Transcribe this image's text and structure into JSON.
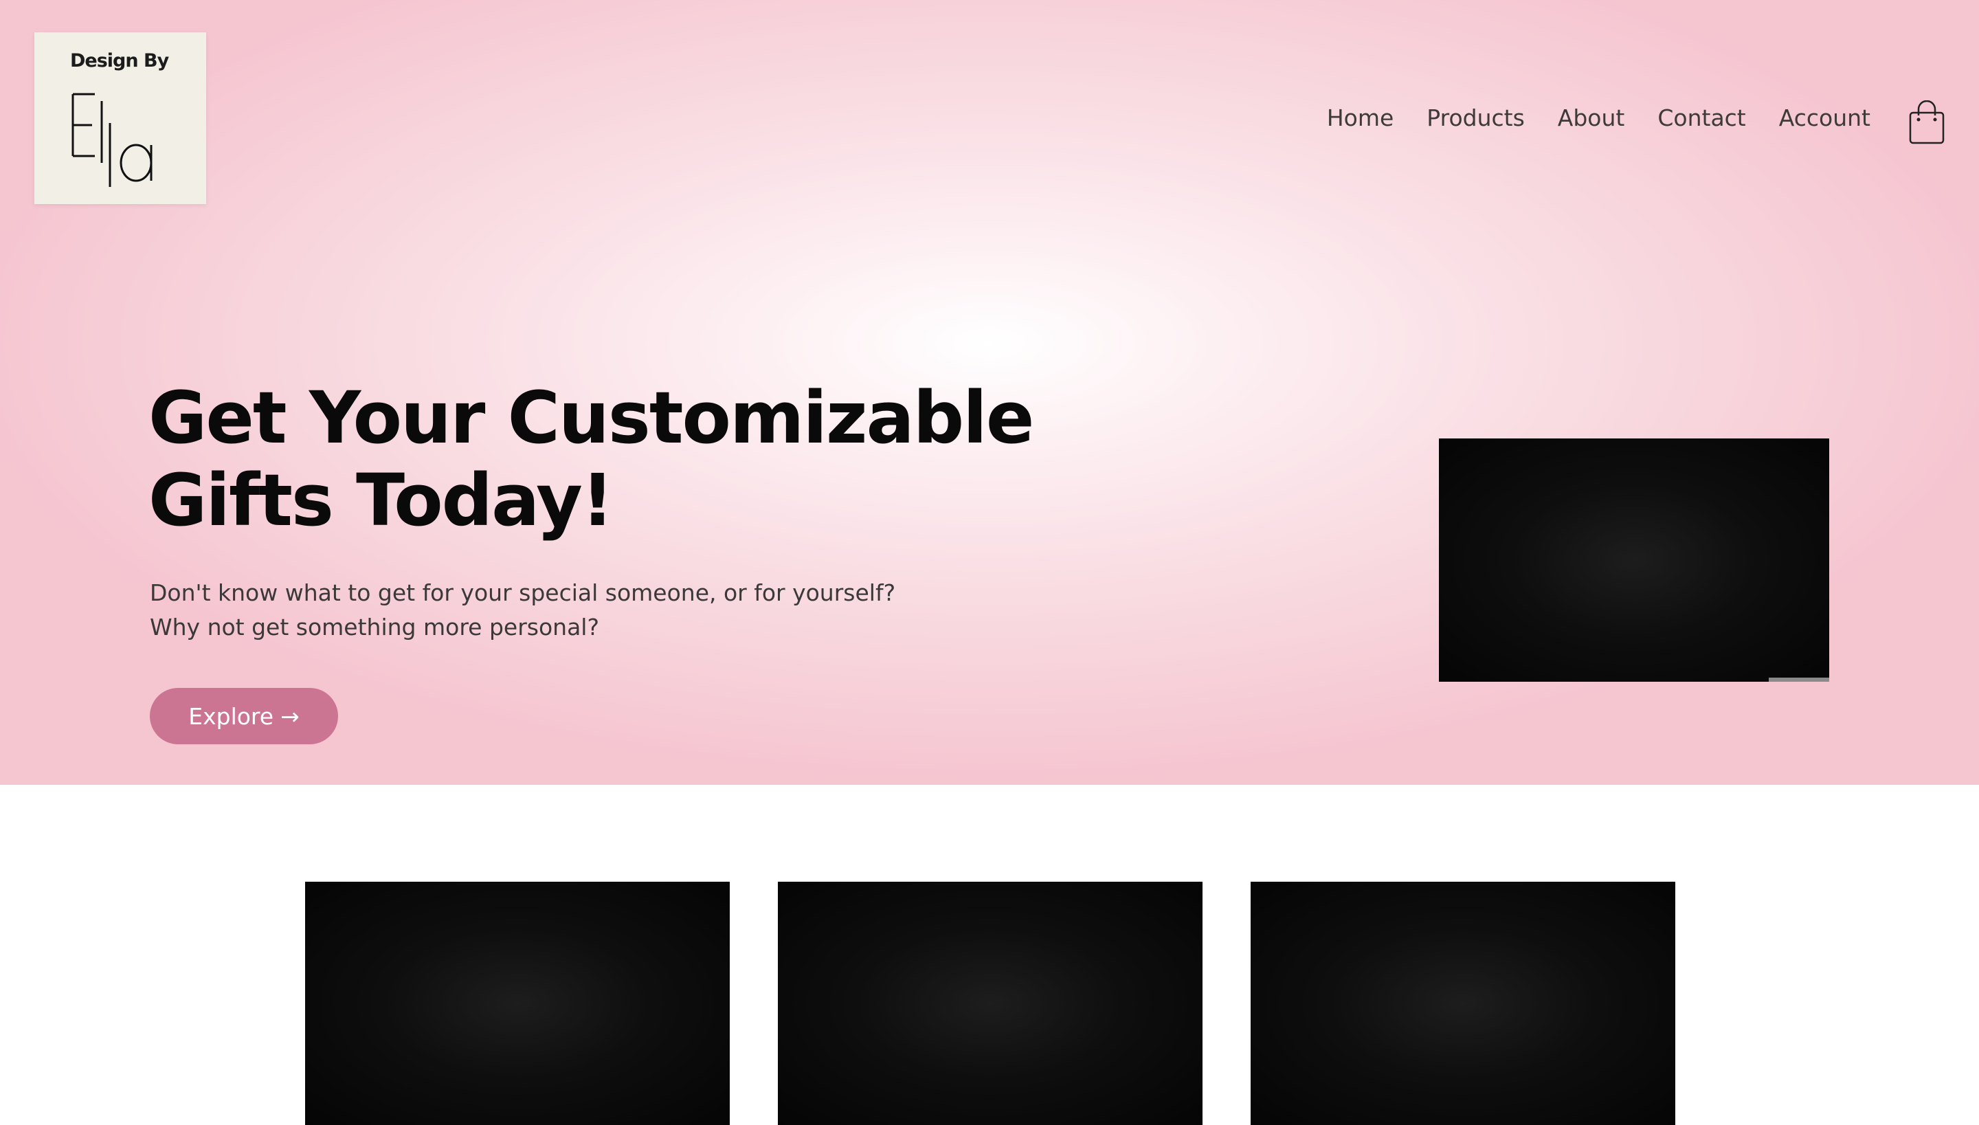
{
  "brand": {
    "logo_top": "Design By",
    "logo_name": "Ella"
  },
  "nav": {
    "items": [
      {
        "label": "Home"
      },
      {
        "label": "Products"
      },
      {
        "label": "About"
      },
      {
        "label": "Contact"
      },
      {
        "label": "Account"
      }
    ],
    "cart_icon": "shopping-bag-icon"
  },
  "hero": {
    "headline_line1": "Get Your Customizable",
    "headline_line2": "Gifts Today!",
    "subtext_line1": "Don't know what to get for your special someone, or for yourself?",
    "subtext_line2": "Why not get something more personal?",
    "cta_label": "Explore",
    "cta_icon": "→"
  },
  "colors": {
    "hero_pink": "#f5c5d0",
    "button": "#cc7593",
    "headline": "#0a0a0a"
  }
}
